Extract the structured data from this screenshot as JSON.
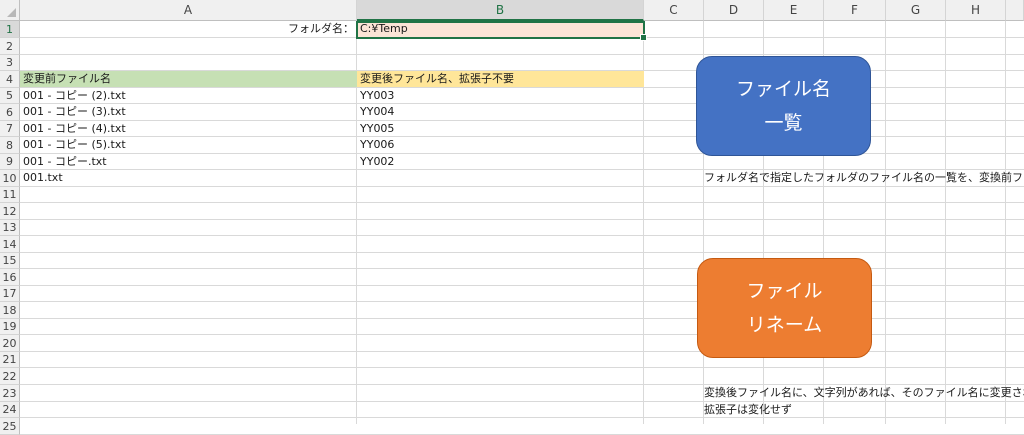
{
  "columns": [
    "A",
    "B",
    "C",
    "D",
    "E",
    "F",
    "G",
    "H"
  ],
  "rows": [
    "1",
    "2",
    "3",
    "4",
    "5",
    "6",
    "7",
    "8",
    "9",
    "10",
    "11",
    "12",
    "13",
    "14",
    "15",
    "16",
    "17",
    "18",
    "19",
    "20",
    "21",
    "22",
    "23",
    "24",
    "25"
  ],
  "folder": {
    "label": "フォルダ名：",
    "value": "C:¥Temp"
  },
  "table": {
    "header_before": "変更前ファイル名",
    "header_after": "変更後ファイル名、拡張子不要",
    "rows": [
      {
        "before": "001 - コピー (2).txt",
        "after": "YY003"
      },
      {
        "before": "001 - コピー (3).txt",
        "after": "YY004"
      },
      {
        "before": "001 - コピー (4).txt",
        "after": "YY005"
      },
      {
        "before": "001 - コピー (5).txt",
        "after": "YY006"
      },
      {
        "before": "001 - コピー.txt",
        "after": "YY002"
      },
      {
        "before": "001.txt",
        "after": ""
      }
    ]
  },
  "buttons": {
    "list": {
      "line1": "ファイル名",
      "line2": "一覧",
      "color": "#4472c4"
    },
    "rename": {
      "line1": "ファイル",
      "line2": "リネーム",
      "color": "#ed7d31"
    }
  },
  "notes": {
    "list_desc": "フォルダ名で指定したフォルダのファイル名の一覧を、変換前ファイル名に設",
    "rename_desc1": "変換後ファイル名に、文字列があれば、そのファイル名に変更される。",
    "rename_desc2": "拡張子は変化せず"
  },
  "colors": {
    "header_green": "#c6e0b4",
    "header_yellow": "#ffe699",
    "selected_fill": "#fce4d6",
    "selection": "#217346"
  }
}
